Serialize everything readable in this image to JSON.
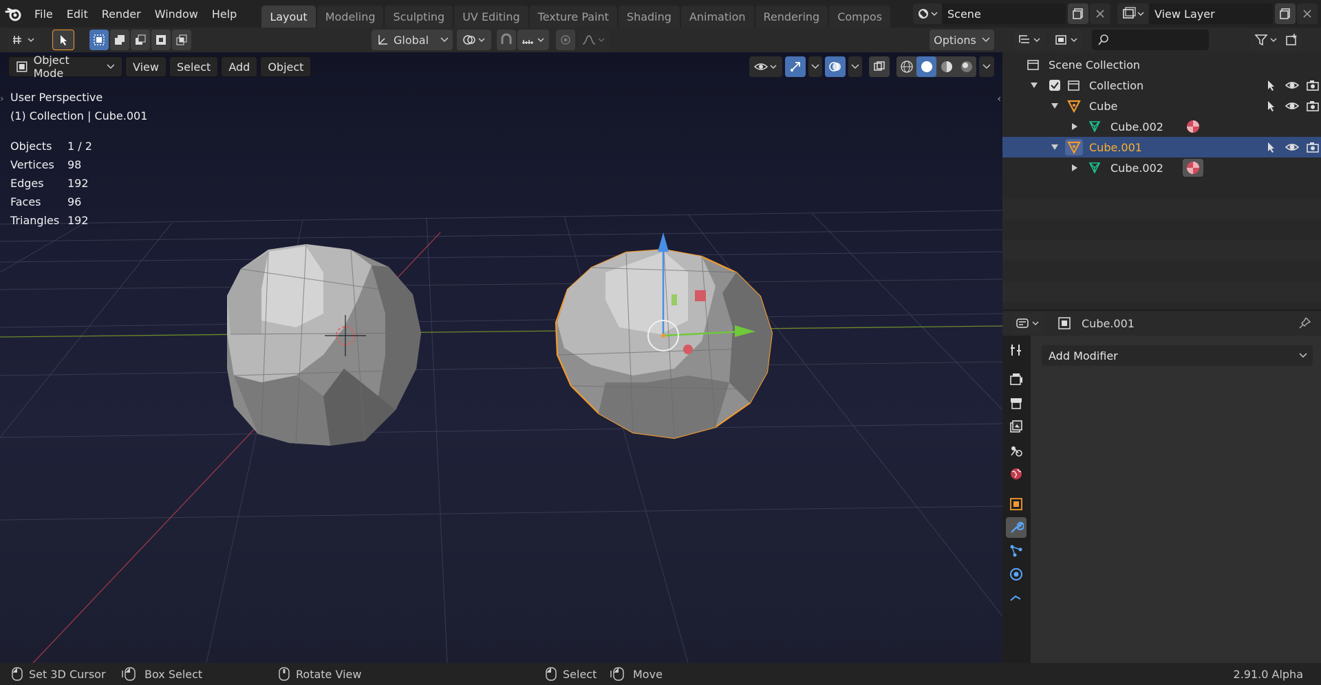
{
  "menu": [
    "File",
    "Edit",
    "Render",
    "Window",
    "Help"
  ],
  "workspaces": [
    "Layout",
    "Modeling",
    "Sculpting",
    "UV Editing",
    "Texture Paint",
    "Shading",
    "Animation",
    "Rendering",
    "Compos"
  ],
  "active_workspace": "Layout",
  "scene": {
    "name": "Scene",
    "view_layer": "View Layer"
  },
  "header": {
    "orientation": "Global",
    "options": "Options"
  },
  "viewport": {
    "mode": "Object Mode",
    "menus": [
      "View",
      "Select",
      "Add",
      "Object"
    ],
    "overlay": {
      "line1": "User Perspective",
      "line2": "(1) Collection | Cube.001"
    },
    "stats": [
      {
        "label": "Objects",
        "value": "1 / 2"
      },
      {
        "label": "Vertices",
        "value": "98"
      },
      {
        "label": "Edges",
        "value": "192"
      },
      {
        "label": "Faces",
        "value": "96"
      },
      {
        "label": "Triangles",
        "value": "192"
      }
    ]
  },
  "outliner": {
    "root": "Scene Collection",
    "collection": "Collection",
    "items": [
      {
        "name": "Cube",
        "mesh": "Cube.002"
      },
      {
        "name": "Cube.001",
        "mesh": "Cube.002"
      }
    ]
  },
  "properties": {
    "object": "Cube.001",
    "add_modifier": "Add Modifier"
  },
  "status": {
    "left": "Set 3D Cursor",
    "box": "Box Select",
    "rotate": "Rotate View",
    "select": "Select",
    "move": "Move",
    "version": "2.91.0 Alpha"
  },
  "colors": {
    "accent": "#4772b3",
    "selected_row": "#334d80",
    "active_object": "#ffaf29",
    "mesh": "#1dbd8f",
    "outline": "#f29a2e"
  }
}
